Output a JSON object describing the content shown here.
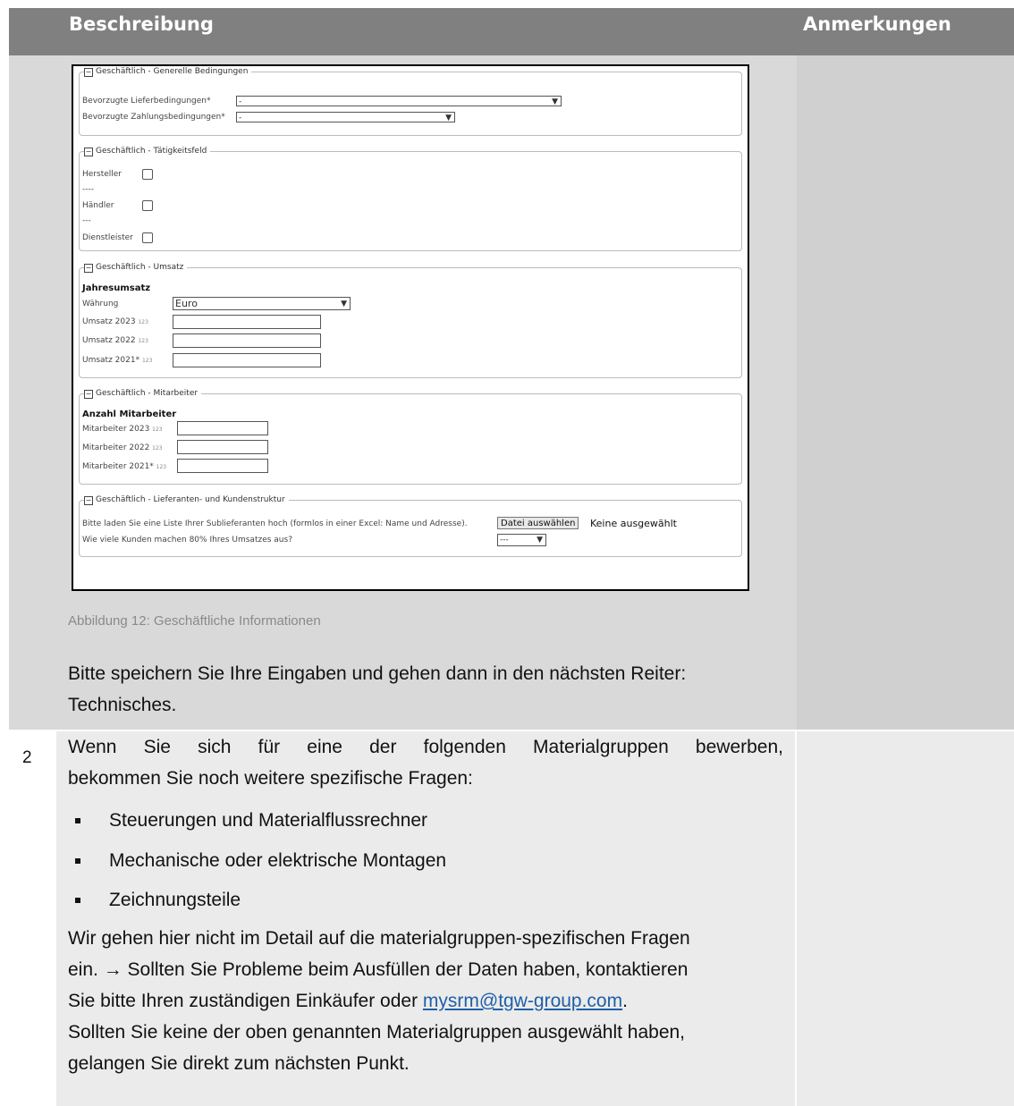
{
  "table": {
    "header_description": "Beschreibung",
    "header_notes": "Anmerkungen",
    "row2_number": "2"
  },
  "screenshot": {
    "sec1": {
      "legend": "Geschäftlich - Generelle Bedingungen",
      "delivery_label": "Bevorzugte Lieferbedingungen*",
      "delivery_value": "-",
      "payment_label": "Bevorzugte Zahlungsbedingungen*",
      "payment_value": "-"
    },
    "sec2": {
      "legend": "Geschäftlich - Tätigkeitsfeld",
      "manufacturer": "Hersteller",
      "sep1": "----",
      "dealer": "Händler",
      "sep2": "---",
      "service": "Dienstleister"
    },
    "sec3": {
      "legend": "Geschäftlich - Umsatz",
      "heading": "Jahresumsatz",
      "currency_label": "Währung",
      "currency_value": "Euro",
      "rev2023": "Umsatz 2023",
      "rev2022": "Umsatz 2022",
      "rev2021": "Umsatz 2021*",
      "num_tag": "123"
    },
    "sec4": {
      "legend": "Geschäftlich - Mitarbeiter",
      "heading": "Anzahl Mitarbeiter",
      "emp2023": "Mitarbeiter 2023",
      "emp2022": "Mitarbeiter 2022",
      "emp2021": "Mitarbeiter 2021*"
    },
    "sec5": {
      "legend": "Geschäftlich - Lieferanten- und Kundenstruktur",
      "upload_text": "Bitte laden Sie eine Liste Ihrer Sublieferanten hoch (formlos in einer Excel: Name und Adresse).",
      "file_button": "Datei auswählen",
      "file_status": "Keine ausgewählt",
      "customers_question": "Wie viele Kunden machen 80% Ihres Umsatzes aus?",
      "customers_value": "---"
    }
  },
  "caption": "Abbildung 12: Geschäftliche Informationen",
  "row1_text_line1": "Bitte speichern Sie Ihre Eingaben und gehen dann in den nächsten Reiter:",
  "row1_text_line2": "Technisches.",
  "row2": {
    "intro_line1": "Wenn Sie sich für eine der folgenden Materialgruppen bewerben,",
    "intro_line2": "bekommen Sie noch weitere spezifische Fragen:",
    "bullets": [
      "Steuerungen und Materialflussrechner",
      "Mechanische oder elektrische Montagen",
      "Zeichnungsteile"
    ],
    "p2_line1": "Wir gehen hier nicht im Detail auf die materialgruppen-spezifischen Fragen",
    "p2_line2": "ein. → Sollten Sie Probleme beim Ausfüllen der Daten haben, kontaktieren",
    "p2_line3_prefix": "Sie bitte Ihren zuständigen Einkäufer oder ",
    "email": "mysrm@tgw-group.com",
    "p2_line3_suffix": ".",
    "p3_line1": "Sollten Sie keine der oben genannten Materialgruppen ausgewählt haben,",
    "p3_line2": "gelangen Sie direkt zum nächsten Punkt."
  }
}
